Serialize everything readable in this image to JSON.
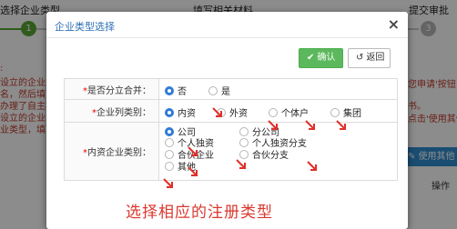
{
  "background": {
    "steps": [
      {
        "label": "选择企业类型",
        "number": "1"
      },
      {
        "label": "填写相关材料",
        "number": ""
      },
      {
        "label": "提交审批",
        "number": "3"
      }
    ],
    "left_lines": [
      ":",
      "设立的企业类",
      "名，然后填写",
      "办理了自主核",
      "设立的企业类",
      "业类型，填写"
    ],
    "right_lines": [
      "您申请'按钮",
      "书。",
      "点击'使用其他"
    ],
    "button_label": "使用其他",
    "op_label": "操作"
  },
  "modal": {
    "title": "企业类型选择",
    "close_symbol": "×",
    "confirm_label": "确认",
    "back_label": "返回",
    "rows": {
      "split": {
        "label": "是否分立合并：",
        "options": [
          "否",
          "是"
        ],
        "selected": "否"
      },
      "category": {
        "label": "企业列类别：",
        "options": [
          "内资",
          "外资",
          "个体户",
          "集团"
        ],
        "selected": "内资"
      },
      "domestic": {
        "label": "内资企业类别：",
        "options": [
          "公司",
          "分公司",
          "个人独资",
          "个人独资分支",
          "合伙企业",
          "合伙分支",
          "其他"
        ],
        "selected": "公司"
      }
    }
  },
  "caption": "选择相应的注册类型",
  "colors": {
    "accent_blue": "#2f7ad8",
    "confirm_green": "#5cb85c",
    "annotation_red": "#d9382e"
  }
}
